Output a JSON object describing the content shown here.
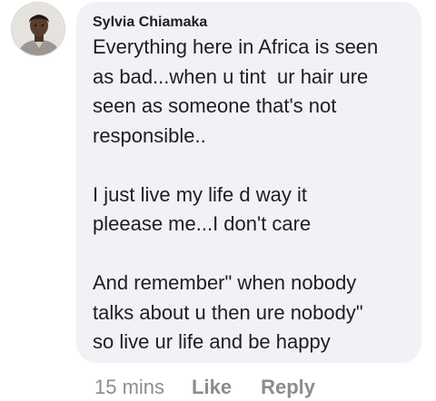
{
  "comment": {
    "author": "Sylvia Chiamaka",
    "paragraphs": [
      "Everything here in Africa is seen\nas bad...when u tint  ur hair ure\nseen as someone that's not\nresponsible..",
      "I just live my life d way it\npleease me...I don't care",
      "And remember\" when nobody\ntalks about u then ure nobody\"\nso live ur life and be happy"
    ],
    "timestamp": "15 mins",
    "like_label": "Like",
    "reply_label": "Reply"
  },
  "colors": {
    "bubble_bg": "#f0f2f5",
    "text": "#1c1e21",
    "meta": "#8a8d91"
  }
}
